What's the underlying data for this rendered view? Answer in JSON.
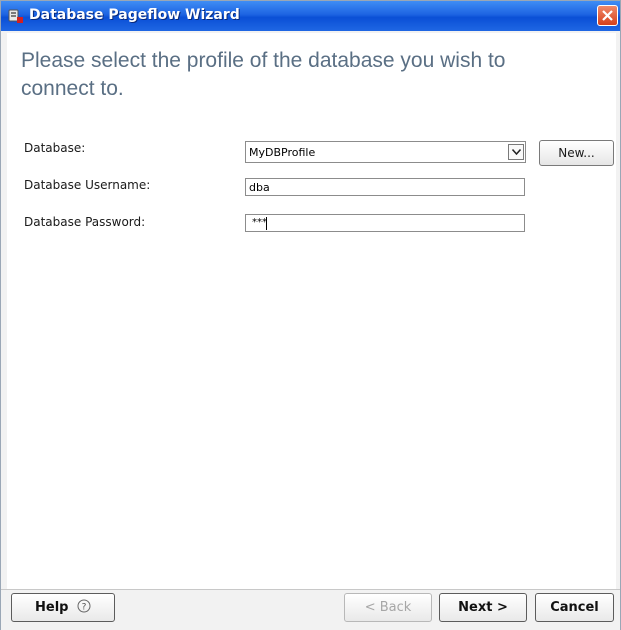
{
  "window": {
    "title": "Database Pageflow Wizard"
  },
  "heading": "Please select the profile of the database you wish to connect to.",
  "form": {
    "database_label": "Database:",
    "database_value": "MyDBProfile",
    "new_button": "New...",
    "username_label": "Database Username:",
    "username_value": "dba",
    "password_label": "Database Password:",
    "password_value": "***"
  },
  "buttons": {
    "help": "Help",
    "help_icon": "?",
    "back": "< Back",
    "next": "Next >",
    "cancel": "Cancel"
  },
  "icons": {
    "app": "database-wizard-icon",
    "close": "close-icon",
    "dropdown": "chevron-down-icon",
    "help": "help-circle-icon"
  },
  "colors": {
    "titlebar": "#1d64e2",
    "heading": "#5a6f84",
    "close": "#d6401c"
  }
}
